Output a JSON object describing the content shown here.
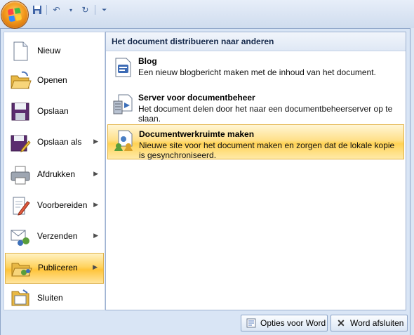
{
  "qat": {
    "save_icon": "save-icon",
    "undo_icon": "undo-icon",
    "redo_icon": "redo-icon",
    "customize_icon": "customize-icon"
  },
  "left_menu": {
    "items": [
      {
        "label": "Nieuw",
        "icon": "new-document-icon",
        "has_submenu": false
      },
      {
        "label": "Openen",
        "icon": "open-folder-icon",
        "has_submenu": false
      },
      {
        "label": "Opslaan",
        "icon": "floppy-disk-icon",
        "has_submenu": false
      },
      {
        "label": "Opslaan als",
        "icon": "save-as-icon",
        "has_submenu": true
      },
      {
        "label": "Afdrukken",
        "icon": "printer-icon",
        "has_submenu": true
      },
      {
        "label": "Voorbereiden",
        "icon": "prepare-icon",
        "has_submenu": true
      },
      {
        "label": "Verzenden",
        "icon": "send-icon",
        "has_submenu": true
      },
      {
        "label": "Publiceren",
        "icon": "publish-folder-icon",
        "has_submenu": true
      },
      {
        "label": "Sluiten",
        "icon": "close-document-icon",
        "has_submenu": false
      }
    ],
    "active_index": 7
  },
  "right_panel": {
    "header": "Het document distribueren naar anderen",
    "items": [
      {
        "title": "Blog",
        "description": "Een nieuw blogbericht maken met de inhoud van het document.",
        "icon": "blog-icon"
      },
      {
        "title": "Server voor documentbeheer",
        "description": "Het document delen door het naar een documentbeheerserver op te slaan.",
        "icon": "document-server-icon"
      },
      {
        "title": "Documentwerkruimte maken",
        "description": "Nieuwe site voor het document maken en zorgen dat de lokale kopie is gesynchroniseerd.",
        "icon": "document-workspace-icon"
      }
    ],
    "active_index": 2
  },
  "footer": {
    "options_label": "Opties voor Word",
    "exit_label": "Word afsluiten"
  }
}
